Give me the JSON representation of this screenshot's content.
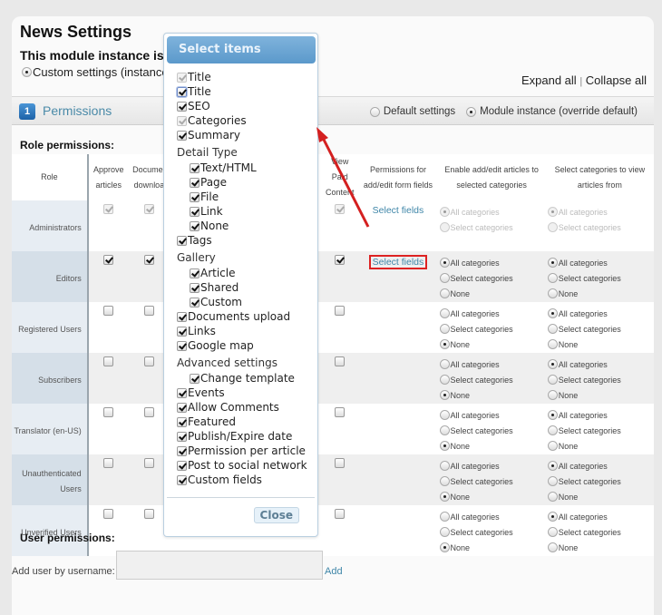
{
  "page": {
    "title": "News Settings",
    "subtitle": "This module instance is u",
    "custom_settings_label": "Custom settings (instance",
    "expand_all": "Expand all",
    "separator": "|",
    "collapse_all": "Collapse all"
  },
  "section": {
    "number": "1",
    "title": "Permissions",
    "scope_options": [
      {
        "label": "Default settings",
        "selected": false
      },
      {
        "label": "Module instance (override default)",
        "selected": true
      }
    ]
  },
  "role_permissions": {
    "label": "Role permissions:",
    "columns": {
      "role": "Role",
      "approve": "Approve articles",
      "approve_l1": "Approve",
      "approve_l2": "articles",
      "docdl_l1": "Documer",
      "docdl_l2": "downloa",
      "vpc_l1": "View Paid",
      "vpc_l2": "Content",
      "pf_l1": "Permissions for",
      "pf_l2": "add/edit form fields",
      "enable_l1": "Enable add/edit articles to",
      "enable_l2": "selected categories",
      "view_l1": "Select categories to view",
      "view_l2": "articles from"
    },
    "select_fields_label": "Select fields",
    "radio_labels": {
      "all": "All categories",
      "select": "Select categories",
      "none": "None"
    },
    "rows": [
      {
        "role": "Administrators",
        "approve": true,
        "doc_download": true,
        "view_paid": true,
        "disabled": true,
        "select_fields": true,
        "enable": "all",
        "view": "all",
        "has_none": false
      },
      {
        "role": "Editors",
        "approve": true,
        "doc_download": true,
        "view_paid": true,
        "disabled": false,
        "select_fields": true,
        "highlighted": true,
        "enable": "all",
        "view": "all",
        "has_none": true
      },
      {
        "role": "Registered Users",
        "approve": false,
        "doc_download": false,
        "view_paid": false,
        "disabled": false,
        "select_fields": false,
        "enable": "none",
        "view": "all",
        "has_none": true
      },
      {
        "role": "Subscribers",
        "approve": false,
        "doc_download": false,
        "view_paid": false,
        "disabled": false,
        "select_fields": false,
        "enable": "none",
        "view": "all",
        "has_none": true
      },
      {
        "role": "Translator (en-US)",
        "approve": false,
        "doc_download": false,
        "view_paid": false,
        "disabled": false,
        "select_fields": false,
        "enable": "none",
        "view": "all",
        "has_none": true
      },
      {
        "role": "Unauthenticated Users",
        "approve": false,
        "doc_download": false,
        "view_paid": false,
        "disabled": false,
        "select_fields": false,
        "enable": "none",
        "view": "all",
        "has_none": true
      },
      {
        "role": "Unverified Users",
        "approve": false,
        "doc_download": false,
        "view_paid": false,
        "disabled": false,
        "select_fields": false,
        "enable": "none",
        "view": "all",
        "has_none": true
      }
    ]
  },
  "user_permissions": {
    "label": "User permissions:",
    "add_user_label": "Add user by username:",
    "input_value": "",
    "add_link": "Add"
  },
  "popup": {
    "title": "Select items",
    "close_label": "Close",
    "items": [
      {
        "type": "item",
        "label": "Title",
        "checked": true,
        "disabled": true,
        "indent": false
      },
      {
        "type": "item",
        "label": "Title",
        "checked": true,
        "disabled": false,
        "indent": false,
        "focus": true
      },
      {
        "type": "item",
        "label": "SEO",
        "checked": true,
        "disabled": false,
        "indent": false
      },
      {
        "type": "item",
        "label": "Categories",
        "checked": true,
        "disabled": true,
        "indent": false
      },
      {
        "type": "item",
        "label": "Summary",
        "checked": true,
        "disabled": false,
        "indent": false
      },
      {
        "type": "group",
        "label": "Detail Type"
      },
      {
        "type": "item",
        "label": "Text/HTML",
        "checked": true,
        "disabled": false,
        "indent": true
      },
      {
        "type": "item",
        "label": "Page",
        "checked": true,
        "disabled": false,
        "indent": true
      },
      {
        "type": "item",
        "label": "File",
        "checked": true,
        "disabled": false,
        "indent": true
      },
      {
        "type": "item",
        "label": "Link",
        "checked": true,
        "disabled": false,
        "indent": true
      },
      {
        "type": "item",
        "label": "None",
        "checked": true,
        "disabled": false,
        "indent": true
      },
      {
        "type": "item",
        "label": "Tags",
        "checked": true,
        "disabled": false,
        "indent": false
      },
      {
        "type": "group",
        "label": "Gallery"
      },
      {
        "type": "item",
        "label": "Article",
        "checked": true,
        "disabled": false,
        "indent": true
      },
      {
        "type": "item",
        "label": "Shared",
        "checked": true,
        "disabled": false,
        "indent": true
      },
      {
        "type": "item",
        "label": "Custom",
        "checked": true,
        "disabled": false,
        "indent": true
      },
      {
        "type": "item",
        "label": "Documents upload",
        "checked": true,
        "disabled": false,
        "indent": false
      },
      {
        "type": "item",
        "label": "Links",
        "checked": true,
        "disabled": false,
        "indent": false
      },
      {
        "type": "item",
        "label": "Google map",
        "checked": true,
        "disabled": false,
        "indent": false
      },
      {
        "type": "group",
        "label": "Advanced settings"
      },
      {
        "type": "item",
        "label": "Change template",
        "checked": true,
        "disabled": false,
        "indent": true
      },
      {
        "type": "item",
        "label": "Events",
        "checked": true,
        "disabled": false,
        "indent": false
      },
      {
        "type": "item",
        "label": "Allow Comments",
        "checked": true,
        "disabled": false,
        "indent": false
      },
      {
        "type": "item",
        "label": "Featured",
        "checked": true,
        "disabled": false,
        "indent": false
      },
      {
        "type": "item",
        "label": "Publish/Expire date",
        "checked": true,
        "disabled": false,
        "indent": false
      },
      {
        "type": "item",
        "label": "Permission per article",
        "checked": true,
        "disabled": false,
        "indent": false
      },
      {
        "type": "item",
        "label": "Post to social network",
        "checked": true,
        "disabled": false,
        "indent": false
      },
      {
        "type": "item",
        "label": "Custom fields",
        "checked": true,
        "disabled": false,
        "indent": false
      }
    ]
  },
  "annotation": {
    "arrow_color": "#d42020"
  }
}
